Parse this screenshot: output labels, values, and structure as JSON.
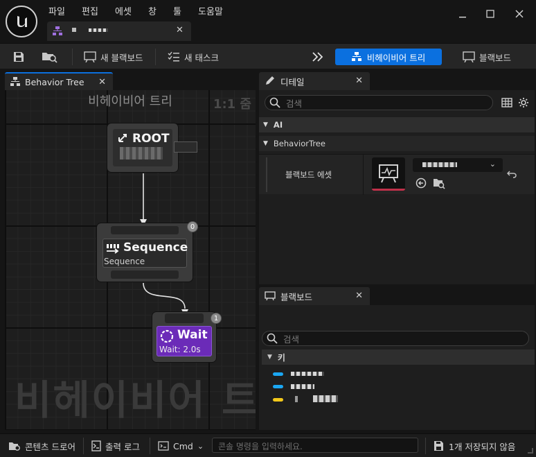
{
  "menu": [
    "파일",
    "편집",
    "에셋",
    "창",
    "툴",
    "도움말"
  ],
  "toolbar": {
    "new_blackboard": "새 블랙보드",
    "new_task": "새 태스크",
    "behavior_tree_mode": "비헤이비어 트리",
    "blackboard_mode": "블랙보드"
  },
  "graph_panel": {
    "tab_label": "Behavior Tree",
    "title": "비헤이비어 트리",
    "zoom": "1:1 줌",
    "watermark": "비헤이비어 트"
  },
  "nodes": {
    "root": {
      "title": "ROOT"
    },
    "sequence": {
      "title": "Sequence",
      "subtitle": "Sequence",
      "index": "0"
    },
    "wait": {
      "title": "Wait",
      "subtitle": "Wait: 2.0s",
      "index": "1"
    }
  },
  "details": {
    "tab_label": "디테일",
    "search_placeholder": "검색",
    "category_ai": "AI",
    "category_bt": "BehaviorTree",
    "property_label": "블랙보드 에셋"
  },
  "blackboard": {
    "tab_label": "블랙보드",
    "search_placeholder": "검색",
    "keys_header": "키",
    "key_colors": [
      "#1ba7f2",
      "#1ba7f2",
      "#f2c81b"
    ]
  },
  "statusbar": {
    "content_drawer": "콘텐츠 드로어",
    "output_log": "출력 로그",
    "cmd": "Cmd",
    "console_placeholder": "콘솔 명령을 입력하세요.",
    "unsaved": "1개 저장되지 않음"
  },
  "colors": {
    "accent": "#0b70df",
    "wait_node": "#6b2bb8",
    "blackboard_underline": "#c0304a"
  }
}
